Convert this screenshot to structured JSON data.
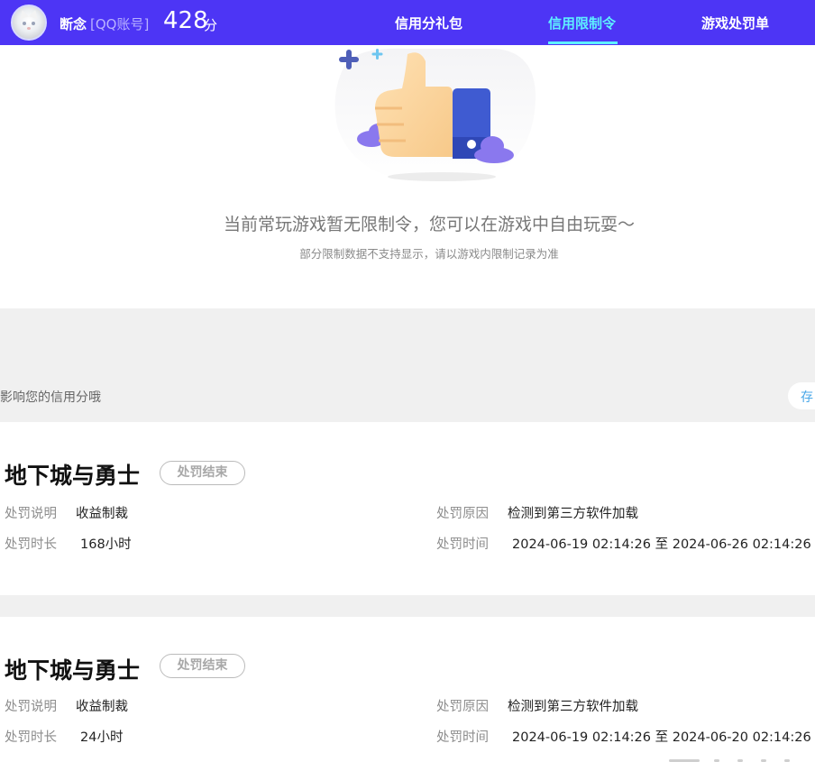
{
  "header": {
    "username": "断念",
    "account_type": "[QQ账号]",
    "score": "428",
    "score_unit": "分",
    "tabs": [
      {
        "label": "信用分礼包",
        "active": false
      },
      {
        "label": "信用限制令",
        "active": true
      },
      {
        "label": "游戏处罚单",
        "active": false
      }
    ],
    "colors": {
      "bar": "#4d35f5",
      "active_tab": "#5ef0ff"
    }
  },
  "empty_state": {
    "title": "当前常玩游戏暂无限制令，您可以在游戏中自由玩耍～",
    "subtitle": "部分限制数据不支持显示，请以游戏内限制记录为准",
    "illustration": "thumbs-up"
  },
  "notice": {
    "text": "影响您的信用分哦",
    "button_label": "存"
  },
  "penalties": [
    {
      "game": "地下城与勇士",
      "status": "处罚结束",
      "desc_label": "处罚说明",
      "desc": "收益制裁",
      "duration_label": "处罚时长",
      "duration": "168小时",
      "reason_label": "处罚原因",
      "reason": "检测到第三方软件加载",
      "time_label": "处罚时间",
      "time": "2024-06-19 02:14:26 至 2024-06-26 02:14:26"
    },
    {
      "game": "地下城与勇士",
      "status": "处罚结束",
      "desc_label": "处罚说明",
      "desc": "收益制裁",
      "duration_label": "处罚时长",
      "duration": "24小时",
      "reason_label": "处罚原因",
      "reason": "检测到第三方软件加载",
      "time_label": "处罚时间",
      "time": "2024-06-19 02:14:26 至 2024-06-20 02:14:26"
    }
  ]
}
